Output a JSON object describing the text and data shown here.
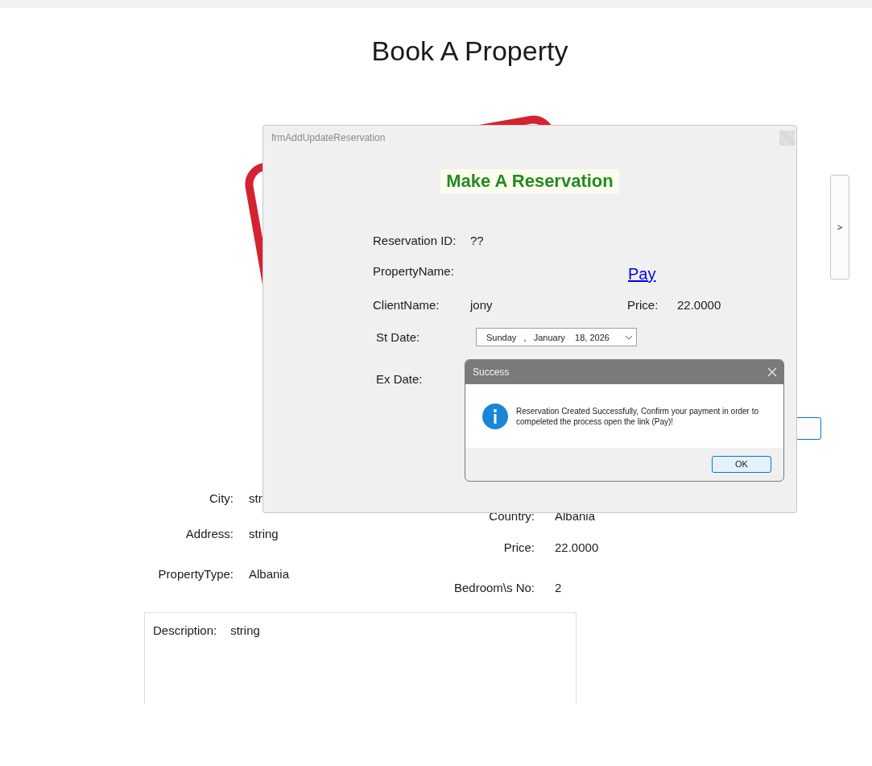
{
  "page": {
    "title": "Book A Property",
    "next_button": ">"
  },
  "property": {
    "fields_left": [
      {
        "label": "City:",
        "value": "str"
      },
      {
        "label": "Address:",
        "value": "string"
      },
      {
        "label": "PropertyType:",
        "value": "Albania"
      }
    ],
    "fields_right": [
      {
        "label": "Country:",
        "value": "Albania"
      },
      {
        "label": "Price:",
        "value": "22.0000"
      },
      {
        "label": "Bedroom\\s No:",
        "value": "2"
      }
    ],
    "description": {
      "label": "Description:",
      "value": "string"
    }
  },
  "form_window": {
    "title": "frmAddUpdateReservation",
    "heading": "Make A Reservation",
    "reservation_id": {
      "label": "Reservation ID:",
      "value": "??"
    },
    "property_name": {
      "label": "PropertyName:"
    },
    "pay_link": "Pay",
    "client_name": {
      "label": "ClientName:",
      "value": "jony"
    },
    "price": {
      "label": "Price:",
      "value": "22.0000"
    },
    "start_date": {
      "label": "St Date:",
      "value": "Sunday   ,   January    18, 2026"
    },
    "end_date": {
      "label": "Ex Date:"
    }
  },
  "message_box": {
    "title": "Success",
    "message": "Reservation Created Successfully, Confirm your payment in order to compeleted the process open the link (Pay)!",
    "ok": "OK"
  }
}
